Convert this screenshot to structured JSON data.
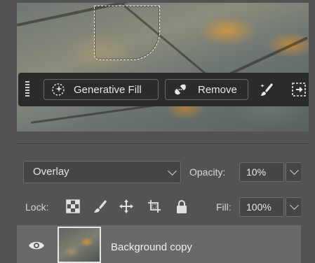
{
  "taskbar": {
    "generative_fill_label": "Generative Fill",
    "remove_label": "Remove"
  },
  "layers": {
    "blend_mode": "Overlay",
    "opacity_label": "Opacity:",
    "opacity_value": "10%",
    "lock_label": "Lock:",
    "fill_label": "Fill:",
    "fill_value": "100%",
    "layer_name": "Background copy"
  },
  "icons": {
    "generative_fill": "sparkle-circle-icon",
    "remove": "bandage-icon",
    "brush": "brush-icon",
    "expand": "transform-icon",
    "lock_transparent": "checkerboard-icon",
    "lock_pixels": "brush-icon",
    "lock_position": "move-icon",
    "lock_artboard": "crop-icon",
    "lock_all": "padlock-icon",
    "visibility": "eye-icon"
  },
  "colors": {
    "panel_bg": "#535353",
    "taskbar_bg": "#2b2b2b",
    "selected_layer_bg": "#696969"
  }
}
